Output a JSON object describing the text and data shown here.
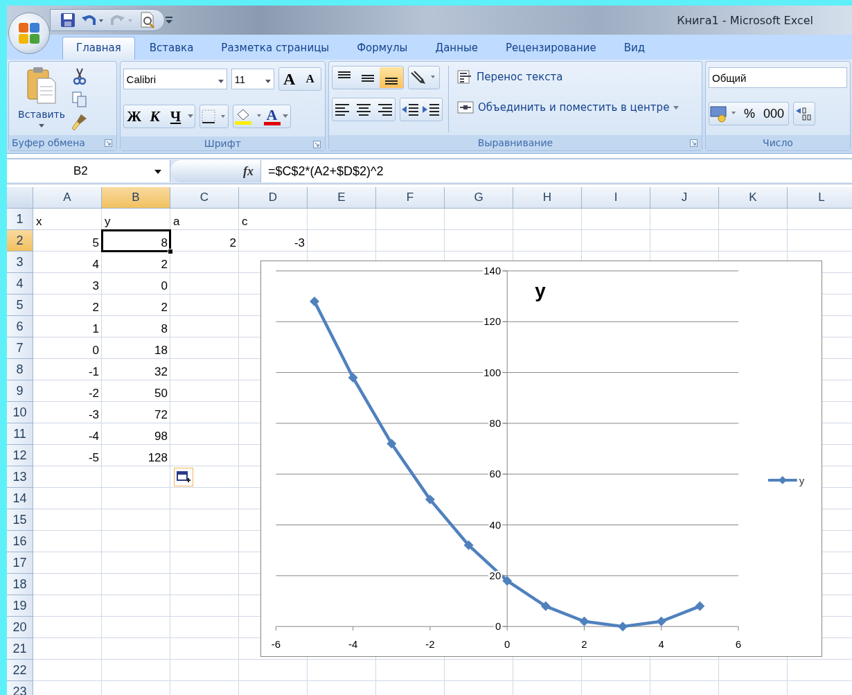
{
  "window": {
    "title": "Книга1 - Microsoft Excel"
  },
  "tabs": [
    {
      "label": "Главная",
      "selected": true
    },
    {
      "label": "Вставка",
      "selected": false
    },
    {
      "label": "Разметка страницы",
      "selected": false
    },
    {
      "label": "Формулы",
      "selected": false
    },
    {
      "label": "Данные",
      "selected": false
    },
    {
      "label": "Рецензирование",
      "selected": false
    },
    {
      "label": "Вид",
      "selected": false
    }
  ],
  "ribbon": {
    "clipboard": {
      "label": "Буфер обмена",
      "paste": "Вставить"
    },
    "font": {
      "label": "Шрифт",
      "name": "Calibri",
      "size": "11",
      "grow": "A",
      "shrink": "A",
      "bold": "Ж",
      "italic": "К",
      "underline": "Ч",
      "color_letter": "A"
    },
    "alignment": {
      "label": "Выравнивание",
      "vertical": [
        {
          "selected": false
        },
        {
          "selected": false
        },
        {
          "selected": true
        }
      ],
      "wrap_text": "Перенос текста",
      "merge_center": "Объединить и поместить в центре"
    },
    "number": {
      "label": "Число",
      "format": "Общий",
      "percent": "%",
      "thousands": "000"
    }
  },
  "formula_bar": {
    "name_box": "B2",
    "fx": "fx",
    "formula": "=$C$2*(A2+$D$2)^2"
  },
  "sheet": {
    "columns": [
      {
        "label": "A",
        "selected": false
      },
      {
        "label": "B",
        "selected": true
      },
      {
        "label": "C",
        "selected": false
      },
      {
        "label": "D",
        "selected": false
      },
      {
        "label": "E",
        "selected": false
      },
      {
        "label": "F",
        "selected": false
      },
      {
        "label": "G",
        "selected": false
      },
      {
        "label": "H",
        "selected": false
      },
      {
        "label": "I",
        "selected": false
      },
      {
        "label": "J",
        "selected": false
      },
      {
        "label": "K",
        "selected": false
      },
      {
        "label": "L",
        "selected": false
      }
    ],
    "rows": [
      {
        "label": "1",
        "selected": false,
        "kind": "text",
        "cells": [
          "x",
          "y",
          "a",
          "c"
        ]
      },
      {
        "label": "2",
        "selected": true,
        "kind": "number",
        "cells": [
          "5",
          "8",
          "2",
          "-3"
        ]
      },
      {
        "label": "3",
        "selected": false,
        "kind": "number",
        "cells": [
          "4",
          "2"
        ]
      },
      {
        "label": "4",
        "selected": false,
        "kind": "number",
        "cells": [
          "3",
          "0"
        ]
      },
      {
        "label": "5",
        "selected": false,
        "kind": "number",
        "cells": [
          "2",
          "2"
        ]
      },
      {
        "label": "6",
        "selected": false,
        "kind": "number",
        "cells": [
          "1",
          "8"
        ]
      },
      {
        "label": "7",
        "selected": false,
        "kind": "number",
        "cells": [
          "0",
          "18"
        ]
      },
      {
        "label": "8",
        "selected": false,
        "kind": "number",
        "cells": [
          "-1",
          "32"
        ]
      },
      {
        "label": "9",
        "selected": false,
        "kind": "number",
        "cells": [
          "-2",
          "50"
        ]
      },
      {
        "label": "10",
        "selected": false,
        "kind": "number",
        "cells": [
          "-3",
          "72"
        ]
      },
      {
        "label": "11",
        "selected": false,
        "kind": "number",
        "cells": [
          "-4",
          "98"
        ]
      },
      {
        "label": "12",
        "selected": false,
        "kind": "number",
        "cells": [
          "-5",
          "128"
        ]
      },
      {
        "label": "13",
        "selected": false,
        "kind": "number"
      },
      {
        "label": "14",
        "selected": false,
        "kind": "number"
      },
      {
        "label": "15",
        "selected": false,
        "kind": "number"
      },
      {
        "label": "16",
        "selected": false,
        "kind": "number"
      },
      {
        "label": "17",
        "selected": false,
        "kind": "number"
      },
      {
        "label": "18",
        "selected": false,
        "kind": "number"
      },
      {
        "label": "19",
        "selected": false,
        "kind": "number"
      },
      {
        "label": "20",
        "selected": false,
        "kind": "number"
      },
      {
        "label": "21",
        "selected": false,
        "kind": "number"
      },
      {
        "label": "22",
        "selected": false,
        "kind": "number"
      },
      {
        "label": "23",
        "selected": false,
        "kind": "number"
      }
    ]
  },
  "chart": {
    "chart_data": {
      "type": "line",
      "title": "y",
      "x": [
        -5,
        -4,
        -3,
        -2,
        -1,
        0,
        1,
        2,
        3,
        4,
        5
      ],
      "series": [
        {
          "name": "y",
          "color": "#4f81bd",
          "marker": "diamond",
          "values": [
            128,
            98,
            72,
            50,
            32,
            18,
            8,
            2,
            0,
            2,
            8
          ]
        }
      ],
      "grid": true,
      "xlim": [
        -6,
        6
      ],
      "ylim": [
        0,
        140
      ],
      "xticks": [
        -6,
        -4,
        -2,
        0,
        2,
        4,
        6
      ],
      "yticks": [
        0,
        20,
        40,
        60,
        80,
        100,
        120,
        140
      ]
    }
  }
}
